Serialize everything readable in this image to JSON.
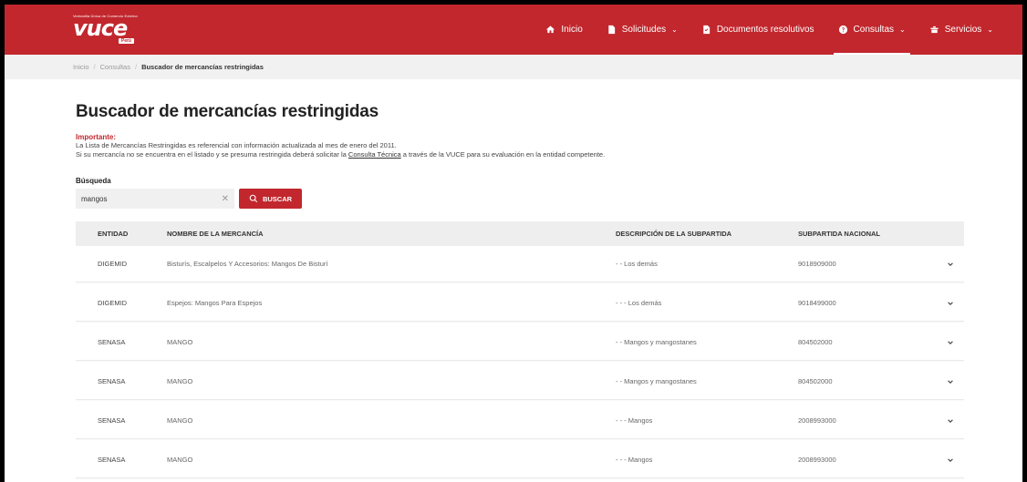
{
  "header": {
    "logo_tagline": "Ventanilla Única de Comercio Exterior",
    "logo_word": "vuce",
    "logo_country": "Perú",
    "nav": [
      {
        "label": "Inicio",
        "icon": "home-icon",
        "chevron": false
      },
      {
        "label": "Solicitudes",
        "icon": "document-icon",
        "chevron": true
      },
      {
        "label": "Documentos resolutivos",
        "icon": "file-check-icon",
        "chevron": false
      },
      {
        "label": "Consultas",
        "icon": "help-circle-icon",
        "chevron": true,
        "active": true
      },
      {
        "label": "Servicios",
        "icon": "services-icon",
        "chevron": true
      }
    ]
  },
  "breadcrumb": {
    "items": [
      "Inicio",
      "Consultas",
      "Buscador de mercancías restringidas"
    ]
  },
  "main": {
    "title": "Buscador de mercancías restringidas",
    "important_label": "Importante:",
    "line1": "La Lista de Mercancías Restringidas es referencial con información actualizada al mes de enero del 2011.",
    "line2_before": "Si su mercancía no se encuentra en el listado y se presuma restringida deberá solicitar la ",
    "line2_link": "Consulta Técnica",
    "line2_after": " a través de la VUCE para su evaluación en la entidad competente.",
    "search_label": "Búsqueda",
    "search_value": "mangos",
    "search_button": "BUSCAR"
  },
  "table": {
    "headers": [
      "ENTIDAD",
      "NOMBRE DE LA MERCANCÍA",
      "DESCRIPCIÓN DE LA SUBPARTIDA",
      "SUBPARTIDA NACIONAL"
    ],
    "rows": [
      [
        "DIGEMID",
        "Bisturís, Escalpelos Y Accesorios: Mangos De Bisturí",
        "- - Los demás",
        "9018909000"
      ],
      [
        "DIGEMID",
        "Espejos: Mangos Para Espejos",
        "- - - Los demás",
        "9018499000"
      ],
      [
        "SENASA",
        "MANGO",
        "- - Mangos y mangostanes",
        "804502000"
      ],
      [
        "SENASA",
        "MANGO",
        "- - Mangos y mangostanes",
        "804502000"
      ],
      [
        "SENASA",
        "MANGO",
        "- - - Mangos",
        "2008993000"
      ],
      [
        "SENASA",
        "MANGO",
        "- - - Mangos",
        "2008993000"
      ]
    ]
  },
  "colors": {
    "brand_red": "#c1272d",
    "breadcrumb_bg": "#f1f1f1",
    "table_header_bg": "#eeeeee"
  }
}
